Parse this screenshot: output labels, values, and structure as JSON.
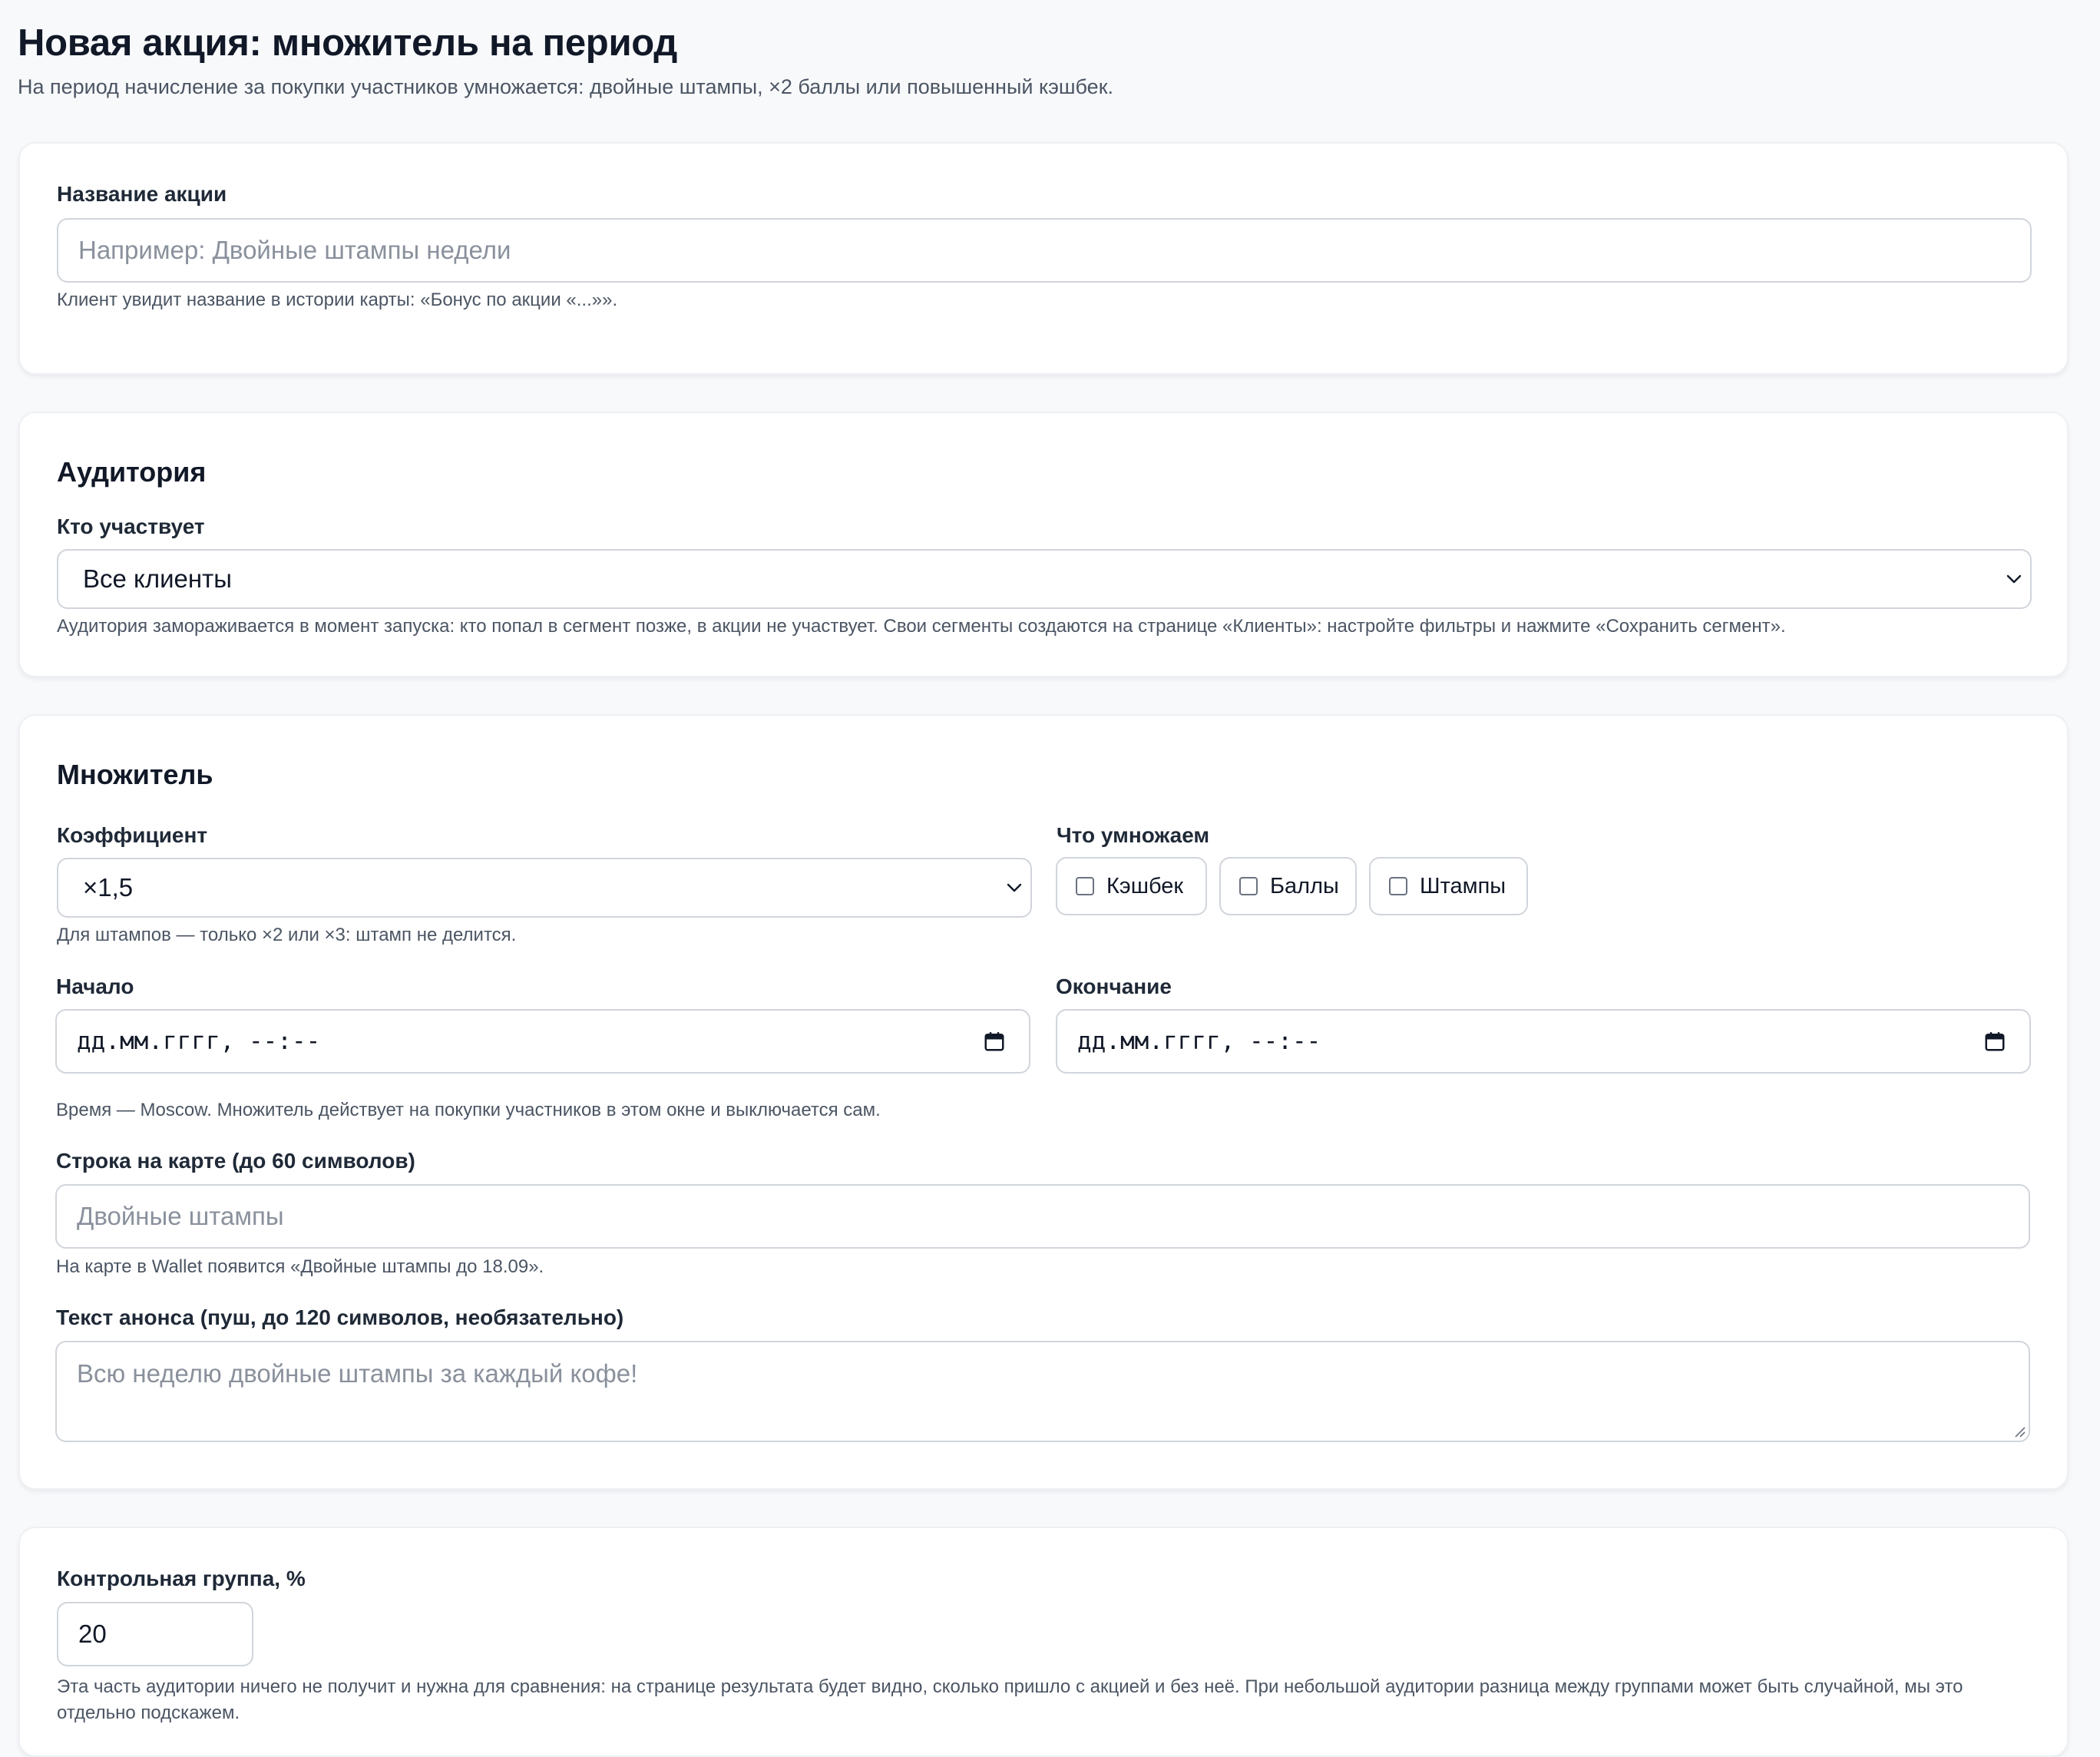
{
  "header": {
    "title": "Новая акция: множитель на период",
    "subtitle": "На период начисление за покупки участников умножается: двойные штампы, ×2 баллы или повышенный кэшбек."
  },
  "name_card": {
    "label": "Название акции",
    "placeholder": "Например: Двойные штампы недели",
    "hint": "Клиент увидит название в истории карты: «Бонус по акции «...»»."
  },
  "audience_card": {
    "title": "Аудитория",
    "label": "Кто участвует",
    "selected": "Все клиенты",
    "hint": "Аудитория замораживается в момент запуска: кто попал в сегмент позже, в акции не участвует. Свои сегменты создаются на странице «Клиенты»: настройте фильтры и нажмите «Сохранить сегмент»."
  },
  "multiplier_card": {
    "title": "Множитель",
    "coef_label": "Коэффициент",
    "coef_selected": "×1,5",
    "coef_hint": "Для штампов — только ×2 или ×3: штамп не делится.",
    "what_label": "Что умножаем",
    "options": [
      {
        "label": "Кэшбек",
        "checked": false
      },
      {
        "label": "Баллы",
        "checked": false
      },
      {
        "label": "Штампы",
        "checked": false
      }
    ],
    "start_label": "Начало",
    "end_label": "Окончание",
    "date_placeholder": "дд.мм.гггг, --:--",
    "time_hint": "Время — Moscow. Множитель действует на покупки участников в этом окне и выключается сам.",
    "card_line_label": "Строка на карте (до 60 символов)",
    "card_line_placeholder": "Двойные штампы",
    "card_line_hint": "На карте в Wallet появится «Двойные штампы до 18.09».",
    "push_label": "Текст анонса (пуш, до 120 символов, необязательно)",
    "push_placeholder": "Всю неделю двойные штампы за каждый кофе!"
  },
  "control_card": {
    "label": "Контрольная группа, %",
    "value": "20",
    "hint": "Эта часть аудитории ничего не получит и нужна для сравнения: на странице результата будет видно, сколько пришло с акцией и без неё. При небольшой аудитории разница между группами может быть случайной, мы это отдельно подскажем."
  }
}
